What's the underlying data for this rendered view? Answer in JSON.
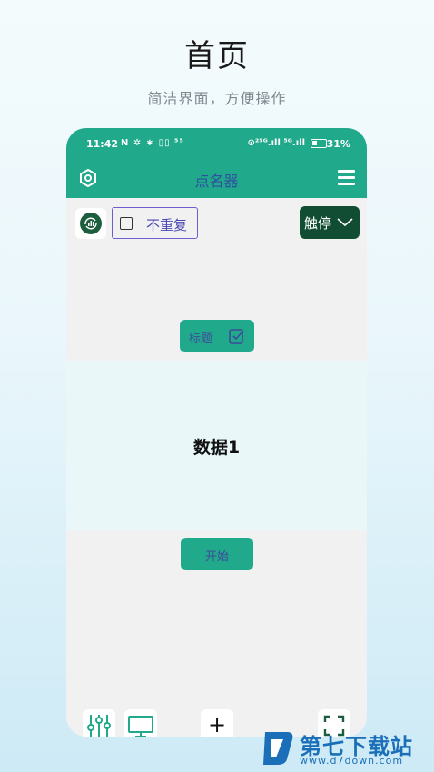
{
  "hero": {
    "title": "首页",
    "subtitle": "简洁界面，方便操作"
  },
  "status_bar": {
    "time": "11:42",
    "left_icons": "N ✲ ∗ ▯▯ ⁵⁵",
    "right_icons": "⊙²⁵ᴳ.ıll ⁵ᴳ.ıll",
    "battery": "31%"
  },
  "app_bar": {
    "title": "点名器",
    "settings_icon": "hexagon-gear-icon",
    "menu_icon": "hamburger-menu-icon"
  },
  "controls": {
    "no_repeat_label": "不重复",
    "no_repeat_checked": false,
    "touch_stop_label": "触停",
    "title_button_label": "标题"
  },
  "display": {
    "data_text": "数据1"
  },
  "actions": {
    "start_label": "开始"
  },
  "bottom_bar": {
    "icons": [
      "sliders-icon",
      "monitor-icon",
      "plus-icon",
      "fullscreen-icon"
    ],
    "plus_symbol": "+"
  },
  "watermark": {
    "name": "第七下载站",
    "url": "www.d7down.com"
  },
  "colors": {
    "accent": "#21a98c",
    "dark_green": "#114d33",
    "purple_text": "#4a48b0",
    "panel": "#e9f7f9"
  }
}
